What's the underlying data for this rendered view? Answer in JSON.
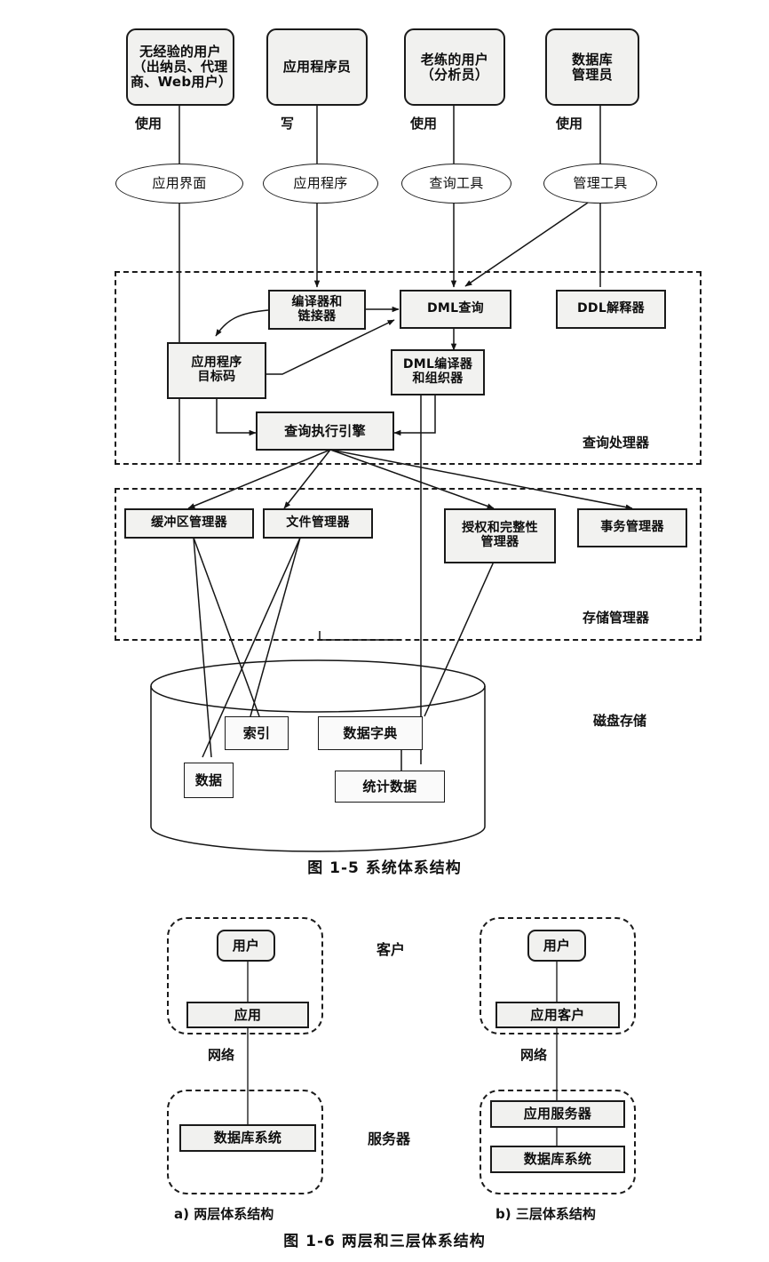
{
  "figure1": {
    "caption": "图 1-5    系统体系结构",
    "actors": [
      {
        "id": "naive-users",
        "label": "无经验的用户\n（出纳员、代理\n商、Web用户）",
        "relation": "使用"
      },
      {
        "id": "app-programmers",
        "label": "应用程序员",
        "relation": "写"
      },
      {
        "id": "sophisticated",
        "label": "老练的用户\n（分析员）",
        "relation": "使用"
      },
      {
        "id": "dba",
        "label": "数据库\n管理员",
        "relation": "使用"
      }
    ],
    "tools": [
      {
        "id": "app-interface",
        "label": "应用界面"
      },
      {
        "id": "app-program",
        "label": "应用程序"
      },
      {
        "id": "query-tool",
        "label": "查询工具"
      },
      {
        "id": "admin-tool",
        "label": "管理工具"
      }
    ],
    "query_processor": {
      "title": "查询处理器",
      "nodes": [
        {
          "id": "compiler-linker",
          "label": "编译器和\n链接器"
        },
        {
          "id": "dml-query",
          "label": "DML查询"
        },
        {
          "id": "ddl-interpreter",
          "label": "DDL解释器"
        },
        {
          "id": "app-object-code",
          "label": "应用程序\n目标码"
        },
        {
          "id": "dml-compiler",
          "label": "DML编译器\n和组织器"
        },
        {
          "id": "query-engine",
          "label": "查询执行引擎"
        }
      ]
    },
    "storage_manager": {
      "title": "存储管理器",
      "nodes": [
        {
          "id": "buffer-manager",
          "label": "缓冲区管理器"
        },
        {
          "id": "file-manager",
          "label": "文件管理器"
        },
        {
          "id": "authorization",
          "label": "授权和完整性\n管理器"
        },
        {
          "id": "transaction-manager",
          "label": "事务管理器"
        }
      ]
    },
    "disk_storage": {
      "title": "磁盘存储",
      "nodes": [
        {
          "id": "index",
          "label": "索引"
        },
        {
          "id": "data-dictionary",
          "label": "数据字典"
        },
        {
          "id": "data",
          "label": "数据"
        },
        {
          "id": "statistics",
          "label": "统计数据"
        }
      ]
    }
  },
  "figure2": {
    "caption": "图 1-6    两层和三层体系结构",
    "side_labels": {
      "client": "客户",
      "server": "服务器"
    },
    "network_label": "网络",
    "two_tier": {
      "subcaption": "a) 两层体系结构",
      "client_nodes": [
        {
          "id": "user",
          "label": "用户"
        },
        {
          "id": "app",
          "label": "应用"
        }
      ],
      "server_nodes": [
        {
          "id": "db-system",
          "label": "数据库系统"
        }
      ]
    },
    "three_tier": {
      "subcaption": "b) 三层体系结构",
      "client_nodes": [
        {
          "id": "user",
          "label": "用户"
        },
        {
          "id": "app-client",
          "label": "应用客户"
        }
      ],
      "server_nodes": [
        {
          "id": "app-server",
          "label": "应用服务器"
        },
        {
          "id": "db-system",
          "label": "数据库系统"
        }
      ]
    }
  }
}
